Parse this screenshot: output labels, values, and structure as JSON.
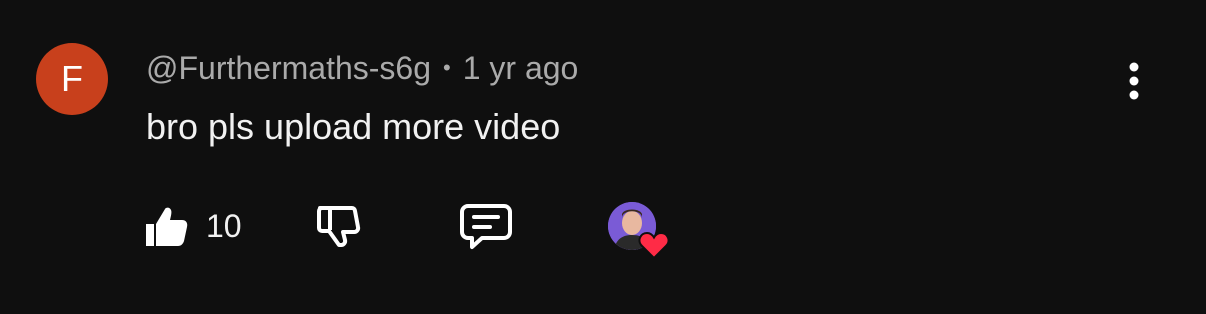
{
  "comment": {
    "avatar_letter": "F",
    "author": "@Furthermaths-s6g",
    "separator": "•",
    "timestamp": "1 yr ago",
    "text": "bro pls upload more video",
    "like_count": "10"
  },
  "icons": {
    "like": "thumbs-up-icon",
    "dislike": "thumbs-down-icon",
    "reply": "comment-icon",
    "more": "vertical-ellipsis-icon",
    "creator_heart": "heart-icon"
  },
  "colors": {
    "background": "#0f0f0f",
    "avatar": "#c8401c",
    "heart": "#ff2b46",
    "meta_text": "#aaaaaa",
    "primary_text": "#f1f1f1"
  }
}
